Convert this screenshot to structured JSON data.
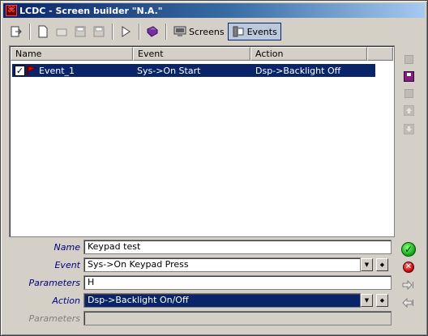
{
  "window": {
    "title": "LCDC - Screen builder \"N.A.\""
  },
  "toolbar": {
    "screens_label": "Screens",
    "events_label": "Events"
  },
  "list": {
    "columns": [
      "Name",
      "Event",
      "Action"
    ],
    "rows": [
      {
        "checked": true,
        "name": "Event_1",
        "event": "Sys->On Start",
        "action": "Dsp->Backlight Off"
      }
    ]
  },
  "form": {
    "name_label": "Name",
    "name_value": "Keypad test",
    "event_label": "Event",
    "event_value": "Sys->On Keypad Press",
    "parameters_label": "Parameters",
    "parameters_value": "H",
    "action_label": "Action",
    "action_value": "Dsp->Backlight On/Off",
    "parameters2_label": "Parameters",
    "parameters2_value": ""
  },
  "colors": {
    "selection": "#0a246a",
    "label": "#000080"
  }
}
